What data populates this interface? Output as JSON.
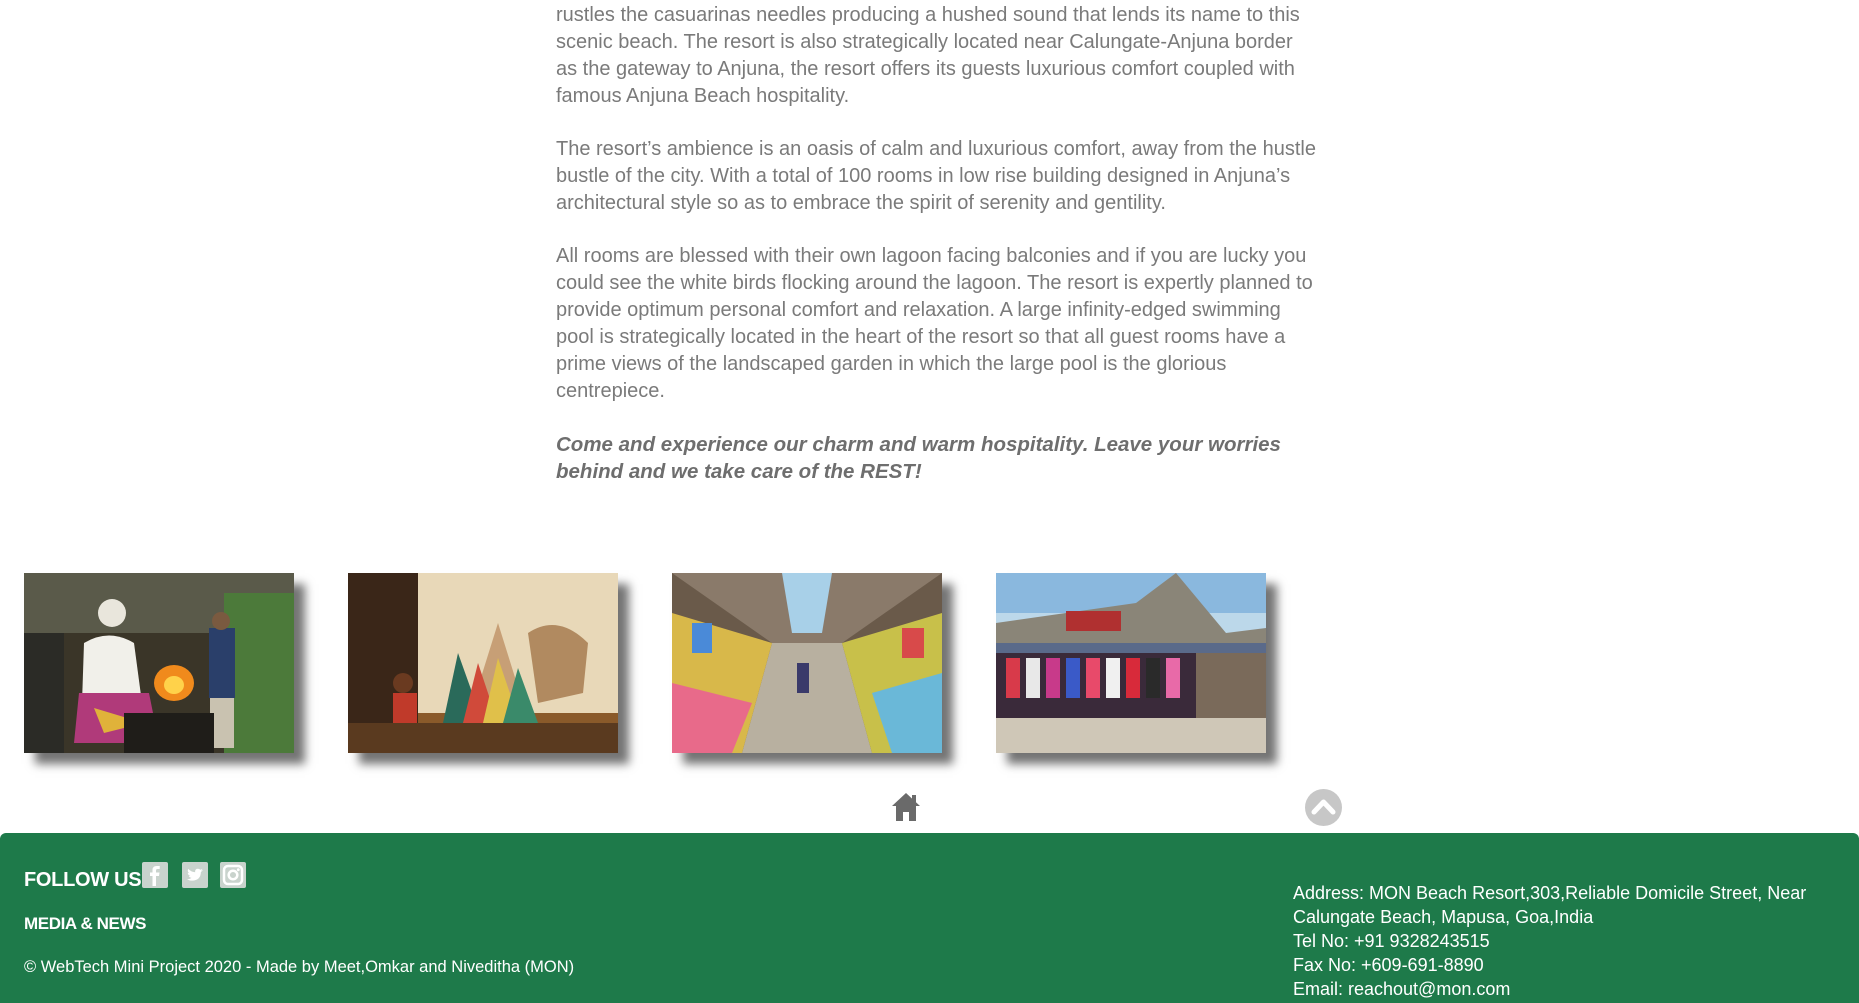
{
  "content": {
    "paragraphs": [
      "rustles the casuarinas needles producing a hushed sound that lends its name to this scenic beach. The resort is also strategically located near Calungate-Anjuna border as the gateway to Anjuna, the resort offers its guests luxurious comfort coupled with famous Anjuna Beach hospitality.",
      "The resort’s ambience is an oasis of calm and luxurious comfort, away from the hustle bustle of the city. With a total of 100 rooms in low rise building designed in Anjuna’s architectural style so as to embrace the spirit of serenity and gentility.",
      "All rooms are blessed with their own lagoon facing balconies and if you are lucky you could see the white birds flocking around the lagoon. The resort is expertly planned to provide optimum personal comfort and relaxation. A large infinity-edged swimming pool is strategically located in the heart of the resort so that all guest rooms have a prime views of the landscaped garden in which the large pool is the glorious centrepiece."
    ],
    "cta": "Come and experience our charm and warm hospitality. Leave your worries behind and we take care of the REST!"
  },
  "gallery": [
    "photo-blacksmith",
    "photo-shadow-puppets",
    "photo-market-aisle",
    "photo-market-stalls"
  ],
  "nav": {
    "home_icon": "home-icon",
    "top_icon": "chevron-up-icon"
  },
  "footer": {
    "follow_label": "FOLLOW US",
    "social": [
      "facebook-icon",
      "twitter-icon",
      "instagram-icon"
    ],
    "media_label": "MEDIA & NEWS",
    "copyright": "© WebTech Mini Project 2020 - Made by Meet,Omkar and Niveditha (MON)",
    "address_lines": [
      "Address: MON Beach Resort,303,Reliable Domicile Street, Near",
      "Calungate Beach, Mapusa, Goa,India",
      "Tel No: +91 9328243515",
      "Fax No: +609-691-8890",
      "Email: reachout@mon.com"
    ],
    "background": "#1e7a4a"
  }
}
